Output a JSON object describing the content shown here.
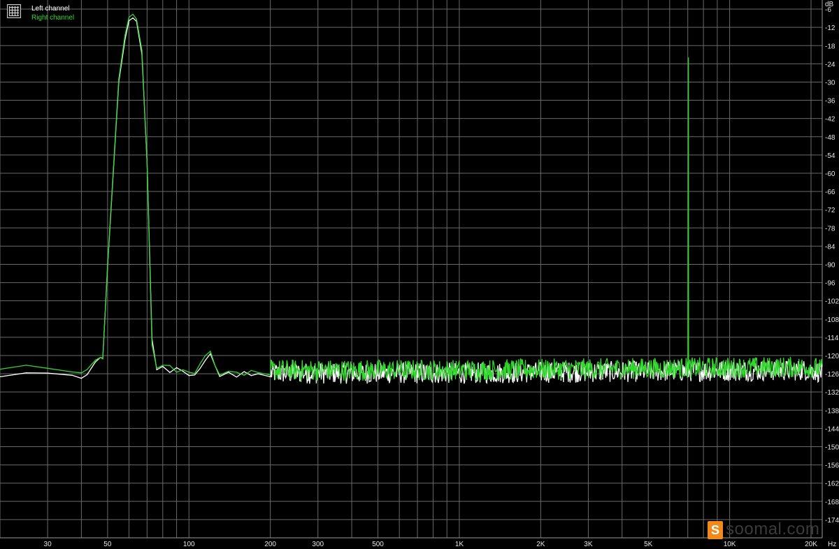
{
  "chart_data": {
    "type": "line",
    "title": "",
    "xlabel": "Hz",
    "ylabel": "dB",
    "x_scale": "log",
    "xlim": [
      20,
      22000
    ],
    "ylim": [
      -180,
      -3
    ],
    "grid": true,
    "legend_position": "top-left",
    "x_ticks": [
      {
        "value": 30,
        "label": "30"
      },
      {
        "value": 50,
        "label": "50"
      },
      {
        "value": 100,
        "label": "100"
      },
      {
        "value": 200,
        "label": "200"
      },
      {
        "value": 300,
        "label": "300"
      },
      {
        "value": 500,
        "label": "500"
      },
      {
        "value": 1000,
        "label": "1K"
      },
      {
        "value": 2000,
        "label": "2K"
      },
      {
        "value": 3000,
        "label": "3K"
      },
      {
        "value": 5000,
        "label": "5K"
      },
      {
        "value": 10000,
        "label": "10K"
      },
      {
        "value": 20000,
        "label": "20K"
      }
    ],
    "y_ticks": [
      -6,
      -12,
      -18,
      -24,
      -30,
      -36,
      -42,
      -48,
      -54,
      -60,
      -66,
      -72,
      -78,
      -84,
      -90,
      -96,
      -102,
      -108,
      -114,
      -120,
      -126,
      -132,
      -138,
      -144,
      -150,
      -156,
      -162,
      -168,
      -174
    ],
    "series": [
      {
        "name": "Left channel",
        "color": "#ffffff",
        "points": [
          [
            20,
            -127.0
          ],
          [
            25,
            -125.7
          ],
          [
            30,
            -125.8
          ],
          [
            37,
            -126.5
          ],
          [
            40,
            -127.5
          ],
          [
            42,
            -126.3
          ],
          [
            45,
            -122.2
          ],
          [
            47,
            -120.6
          ],
          [
            48,
            -120.9
          ],
          [
            50,
            -90.6
          ],
          [
            55,
            -29.9
          ],
          [
            58,
            -16.0
          ],
          [
            60,
            -9.8
          ],
          [
            62,
            -8.9
          ],
          [
            64,
            -10.0
          ],
          [
            67,
            -20.9
          ],
          [
            70,
            -56.7
          ],
          [
            73,
            -114.5
          ],
          [
            76,
            -124.7
          ],
          [
            80,
            -123.6
          ],
          [
            85,
            -125.6
          ],
          [
            90,
            -124.0
          ],
          [
            95,
            -125.2
          ],
          [
            100,
            -126.6
          ],
          [
            105,
            -126.4
          ],
          [
            110,
            -124.2
          ],
          [
            115,
            -121.6
          ],
          [
            120,
            -119.4
          ],
          [
            125,
            -123.4
          ],
          [
            130,
            -126.9
          ],
          [
            140,
            -125.5
          ],
          [
            150,
            -127.1
          ],
          [
            160,
            -125.3
          ],
          [
            170,
            -126.6
          ],
          [
            180,
            -126.0
          ],
          [
            200,
            -127.0
          ]
        ]
      },
      {
        "name": "Right channel",
        "color": "#32d72d",
        "points": [
          [
            20,
            -124.5
          ],
          [
            25,
            -123.2
          ],
          [
            30,
            -124.2
          ],
          [
            37,
            -125.4
          ],
          [
            40,
            -125.7
          ],
          [
            42,
            -124.6
          ],
          [
            45,
            -121.6
          ],
          [
            47,
            -120.6
          ],
          [
            48,
            -121.1
          ],
          [
            50,
            -90.1
          ],
          [
            55,
            -29.0
          ],
          [
            58,
            -14.6
          ],
          [
            60,
            -8.7
          ],
          [
            62,
            -7.7
          ],
          [
            64,
            -9.3
          ],
          [
            67,
            -19.6
          ],
          [
            70,
            -57.0
          ],
          [
            73,
            -116.4
          ],
          [
            76,
            -124.2
          ],
          [
            80,
            -123.2
          ],
          [
            85,
            -123.3
          ],
          [
            90,
            -125.5
          ],
          [
            95,
            -124.7
          ],
          [
            100,
            -125.5
          ],
          [
            105,
            -125.9
          ],
          [
            110,
            -122.7
          ],
          [
            115,
            -120.0
          ],
          [
            120,
            -118.6
          ],
          [
            125,
            -123.4
          ],
          [
            130,
            -126.4
          ],
          [
            140,
            -125.2
          ],
          [
            150,
            -125.5
          ],
          [
            160,
            -126.5
          ],
          [
            170,
            -124.9
          ],
          [
            180,
            -125.6
          ],
          [
            200,
            -126.4
          ],
          [
            7000,
            -125.0
          ],
          [
            7040,
            -22.0
          ],
          [
            7080,
            -125.0
          ]
        ]
      }
    ],
    "noise_floor": {
      "from_hz": 200,
      "to_hz": 22000,
      "center_db": [
        [
          200,
          -125.2
        ],
        [
          1000,
          -125.2
        ],
        [
          5000,
          -124.6
        ],
        [
          20000,
          -124.2
        ],
        [
          22000,
          -125.0
        ]
      ],
      "spread_db": 3.5
    }
  },
  "legend": {
    "left_label": "Left channel",
    "right_label": "Right channel"
  },
  "axis": {
    "x_unit_label": "Hz",
    "y_unit_label": "dB"
  },
  "watermark": {
    "text": "soomal.com",
    "logo_glyph": "S"
  },
  "colors": {
    "background": "#000000",
    "grid": "#6a6a6a",
    "tick_text": "#e6e6e6",
    "left": "#ffffff",
    "right": "#32d72d"
  }
}
